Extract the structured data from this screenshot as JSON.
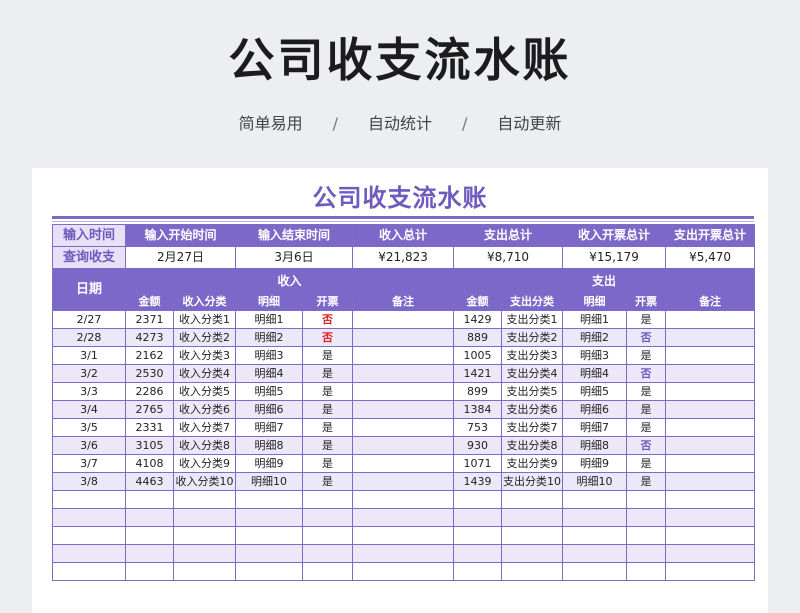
{
  "hero": {
    "title": "公司收支流水账",
    "tags": [
      "简单易用",
      "自动统计",
      "自动更新"
    ],
    "separator": "/"
  },
  "sheet": {
    "title": "公司收支流水账",
    "summary": {
      "label_input_time": "输入时间",
      "label_query": "查询收支",
      "headers": [
        "输入开始时间",
        "输入结束时间",
        "收入总计",
        "支出总计",
        "收入开票总计",
        "支出开票总计"
      ],
      "values": [
        "2月27日",
        "3月6日",
        "¥21,823",
        "¥8,710",
        "¥15,179",
        "¥5,470"
      ]
    },
    "table": {
      "date_header": "日期",
      "income_header": "收入",
      "expense_header": "支出",
      "income_columns": [
        "金额",
        "收入分类",
        "明细",
        "开票",
        "备注"
      ],
      "expense_columns": [
        "金额",
        "支出分类",
        "明细",
        "开票",
        "备注"
      ],
      "rows": [
        {
          "date": "2/27",
          "in_amount": "2371",
          "in_cat": "收入分类1",
          "in_detail": "明细1",
          "in_invoice": "否",
          "in_note": "",
          "out_amount": "1429",
          "out_cat": "支出分类1",
          "out_detail": "明细1",
          "out_invoice": "是",
          "out_note": ""
        },
        {
          "date": "2/28",
          "in_amount": "4273",
          "in_cat": "收入分类2",
          "in_detail": "明细2",
          "in_invoice": "否",
          "in_note": "",
          "out_amount": "889",
          "out_cat": "支出分类2",
          "out_detail": "明细2",
          "out_invoice": "否",
          "out_note": ""
        },
        {
          "date": "3/1",
          "in_amount": "2162",
          "in_cat": "收入分类3",
          "in_detail": "明细3",
          "in_invoice": "是",
          "in_note": "",
          "out_amount": "1005",
          "out_cat": "支出分类3",
          "out_detail": "明细3",
          "out_invoice": "是",
          "out_note": ""
        },
        {
          "date": "3/2",
          "in_amount": "2530",
          "in_cat": "收入分类4",
          "in_detail": "明细4",
          "in_invoice": "是",
          "in_note": "",
          "out_amount": "1421",
          "out_cat": "支出分类4",
          "out_detail": "明细4",
          "out_invoice": "否",
          "out_note": ""
        },
        {
          "date": "3/3",
          "in_amount": "2286",
          "in_cat": "收入分类5",
          "in_detail": "明细5",
          "in_invoice": "是",
          "in_note": "",
          "out_amount": "899",
          "out_cat": "支出分类5",
          "out_detail": "明细5",
          "out_invoice": "是",
          "out_note": ""
        },
        {
          "date": "3/4",
          "in_amount": "2765",
          "in_cat": "收入分类6",
          "in_detail": "明细6",
          "in_invoice": "是",
          "in_note": "",
          "out_amount": "1384",
          "out_cat": "支出分类6",
          "out_detail": "明细6",
          "out_invoice": "是",
          "out_note": ""
        },
        {
          "date": "3/5",
          "in_amount": "2331",
          "in_cat": "收入分类7",
          "in_detail": "明细7",
          "in_invoice": "是",
          "in_note": "",
          "out_amount": "753",
          "out_cat": "支出分类7",
          "out_detail": "明细7",
          "out_invoice": "是",
          "out_note": ""
        },
        {
          "date": "3/6",
          "in_amount": "3105",
          "in_cat": "收入分类8",
          "in_detail": "明细8",
          "in_invoice": "是",
          "in_note": "",
          "out_amount": "930",
          "out_cat": "支出分类8",
          "out_detail": "明细8",
          "out_invoice": "否",
          "out_note": ""
        },
        {
          "date": "3/7",
          "in_amount": "4108",
          "in_cat": "收入分类9",
          "in_detail": "明细9",
          "in_invoice": "是",
          "in_note": "",
          "out_amount": "1071",
          "out_cat": "支出分类9",
          "out_detail": "明细9",
          "out_invoice": "是",
          "out_note": ""
        },
        {
          "date": "3/8",
          "in_amount": "4463",
          "in_cat": "收入分类10",
          "in_detail": "明细10",
          "in_invoice": "是",
          "in_note": "",
          "out_amount": "1439",
          "out_cat": "支出分类10",
          "out_detail": "明细10",
          "out_invoice": "是",
          "out_note": ""
        },
        {
          "date": "",
          "in_amount": "",
          "in_cat": "",
          "in_detail": "",
          "in_invoice": "",
          "in_note": "",
          "out_amount": "",
          "out_cat": "",
          "out_detail": "",
          "out_invoice": "",
          "out_note": ""
        },
        {
          "date": "",
          "in_amount": "",
          "in_cat": "",
          "in_detail": "",
          "in_invoice": "",
          "in_note": "",
          "out_amount": "",
          "out_cat": "",
          "out_detail": "",
          "out_invoice": "",
          "out_note": ""
        },
        {
          "date": "",
          "in_amount": "",
          "in_cat": "",
          "in_detail": "",
          "in_invoice": "",
          "in_note": "",
          "out_amount": "",
          "out_cat": "",
          "out_detail": "",
          "out_invoice": "",
          "out_note": ""
        },
        {
          "date": "",
          "in_amount": "",
          "in_cat": "",
          "in_detail": "",
          "in_invoice": "",
          "in_note": "",
          "out_amount": "",
          "out_cat": "",
          "out_detail": "",
          "out_invoice": "",
          "out_note": ""
        },
        {
          "date": "",
          "in_amount": "",
          "in_cat": "",
          "in_detail": "",
          "in_invoice": "",
          "in_note": "",
          "out_amount": "",
          "out_cat": "",
          "out_detail": "",
          "out_invoice": "",
          "out_note": ""
        }
      ]
    }
  },
  "colors": {
    "accent": "#7b68c8",
    "accent_text": "#6e5bbf",
    "alt_row": "#ece8f8",
    "invoice_no_income": "#d9262c",
    "invoice_no_expense": "#6e5bbf"
  }
}
